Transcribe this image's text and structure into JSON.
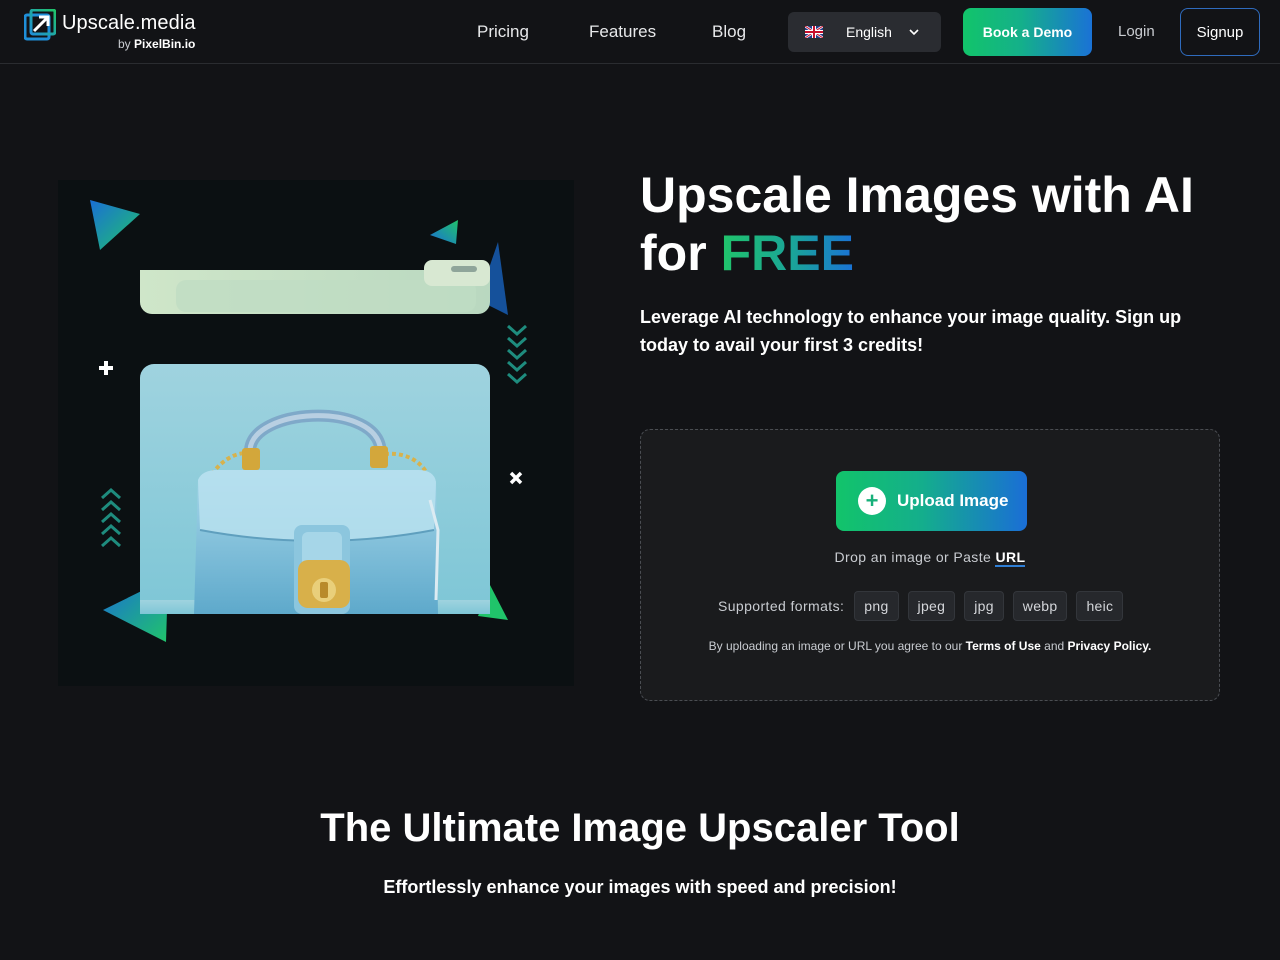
{
  "nav": {
    "logo": {
      "name": "Upscale.media",
      "by_prefix": "by",
      "by_brand": "PixelBin.io"
    },
    "links": [
      "Pricing",
      "Features",
      "Blog"
    ],
    "language": {
      "label": "English",
      "flag_icon": "uk-flag-icon"
    },
    "book_demo_label": "Book a Demo",
    "login_label": "Login",
    "signup_label": "Signup"
  },
  "hero": {
    "title_line1": "Upscale Images with AI",
    "title_line2_prefix": "for",
    "title_highlight": "FREE",
    "lead": "Leverage AI technology to enhance your image quality. Sign up today to avail your first 3 credits!"
  },
  "upload": {
    "button_label": "Upload Image",
    "drop_text": "Drop an image or Paste",
    "url_label": "URL",
    "formats_label": "Supported formats:",
    "formats": [
      "png",
      "jpeg",
      "jpg",
      "webp",
      "heic"
    ],
    "terms_prefix": "By uploading an image or URL you agree to our",
    "terms_link": "Terms of Use",
    "terms_and": "and",
    "privacy_link": "Privacy Policy."
  },
  "section": {
    "title": "The Ultimate Image Upscaler Tool",
    "subtitle": "Effortlessly enhance your images with speed and precision!"
  },
  "colors": {
    "background": "#121316",
    "accent_green": "#12c46a",
    "accent_blue": "#1a72d6",
    "panel": "#1a1b1d"
  }
}
